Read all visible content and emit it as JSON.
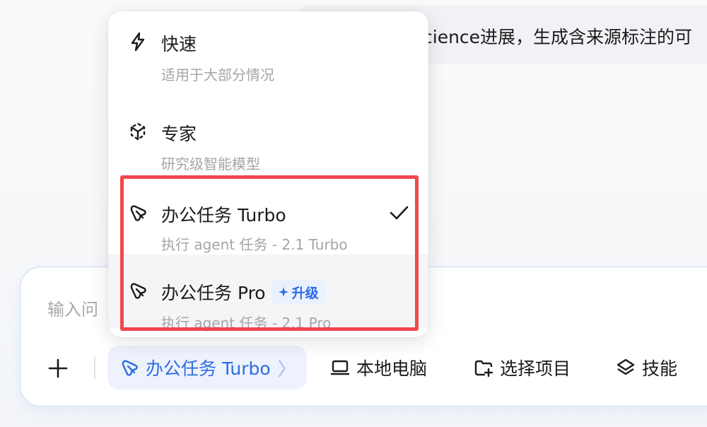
{
  "background_message": {
    "text": "cience进展，生成含来源标注的可"
  },
  "model_menu": {
    "items": [
      {
        "title": "快速",
        "subtitle": "适用于大部分情况",
        "icon": "lightning-icon"
      },
      {
        "title": "专家",
        "subtitle": "研究级智能模型",
        "icon": "expert-cube-icon"
      },
      {
        "title": "办公任务 Turbo",
        "subtitle": "执行 agent 任务 - 2.1 Turbo",
        "icon": "agent-cursor-icon",
        "selected": true
      },
      {
        "title": "办公任务 Pro",
        "subtitle": "执行 agent 任务 - 2.1 Pro",
        "icon": "agent-cursor-icon",
        "badge": "升级"
      }
    ]
  },
  "composer": {
    "placeholder": "输入问",
    "mode_label": "办公任务 Turbo",
    "mode_chevron": "〉",
    "tools": [
      {
        "label": "本地电脑",
        "icon": "laptop-icon"
      },
      {
        "label": "选择项目",
        "icon": "folder-add-icon"
      },
      {
        "label": "技能",
        "icon": "layers-icon"
      }
    ]
  },
  "colors": {
    "accent": "#2e6de0",
    "highlight": "#f0484e",
    "chip_bg": "#edf2fd"
  }
}
